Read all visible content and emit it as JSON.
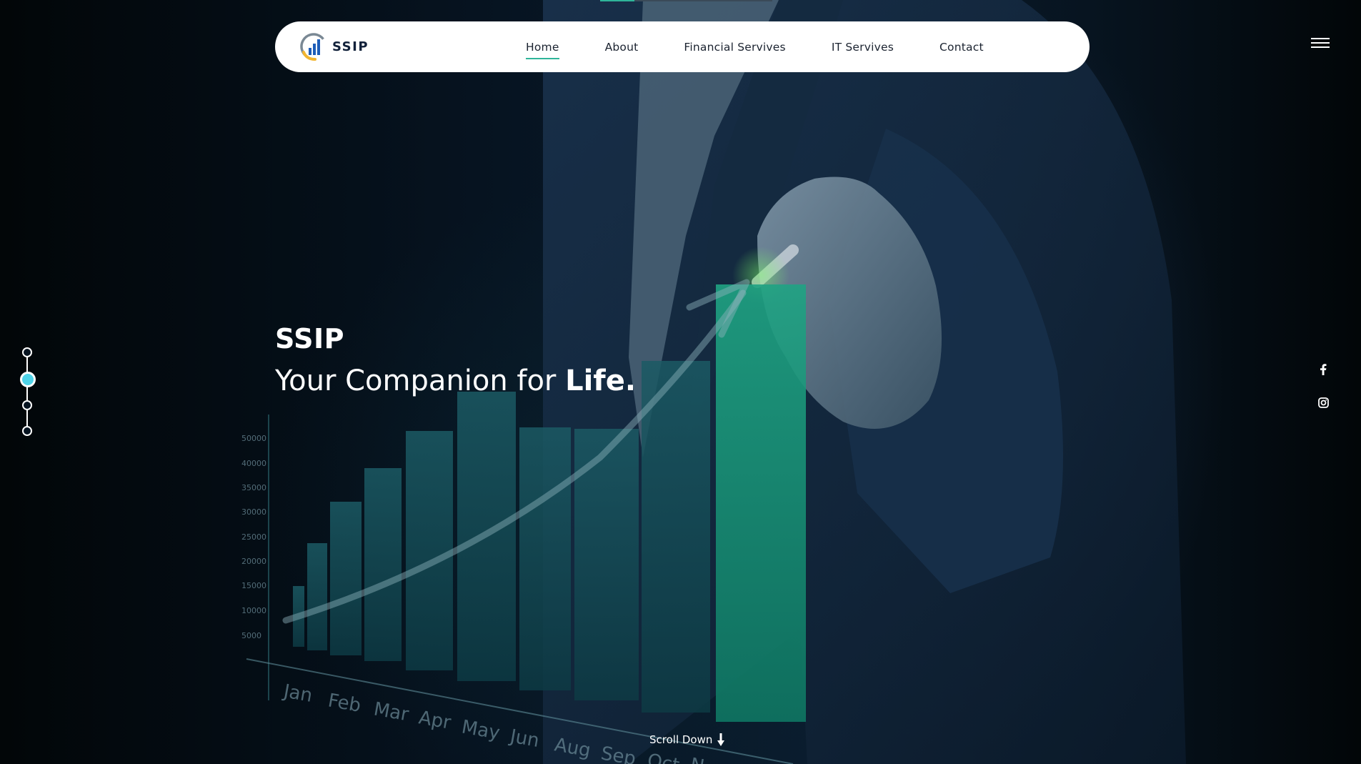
{
  "brand": {
    "name": "SSIP",
    "logo_icon": "bar-chart-logo-icon"
  },
  "nav": {
    "items": [
      {
        "label": "Home",
        "active": true
      },
      {
        "label": "About",
        "active": false
      },
      {
        "label": "Financial Servives",
        "active": false
      },
      {
        "label": "IT Servives",
        "active": false
      },
      {
        "label": "Contact",
        "active": false
      }
    ],
    "menu_icon": "hamburger-menu-icon"
  },
  "hero": {
    "title": "SSIP",
    "subtitle_prefix": "Your Companion for",
    "subtitle_emphasis": "Life.",
    "background": "businessman drawing growth chart",
    "scroll_label": "Scroll Down",
    "scroll_icon": "arrow-down-icon"
  },
  "background_chart": {
    "y_ticks": [
      "50000",
      "40000",
      "35000",
      "30000",
      "25000",
      "20000",
      "15000",
      "10000",
      "5000"
    ],
    "months": [
      "Jan",
      "Feb",
      "Mar",
      "Apr",
      "May",
      "Jun",
      "Aug",
      "Sep",
      "Oct",
      "N"
    ]
  },
  "slide_nav": {
    "count": 4,
    "active_index": 1
  },
  "social": [
    {
      "icon": "facebook-icon"
    },
    {
      "icon": "instagram-icon"
    }
  ],
  "colors": {
    "accent": "#2fb59a",
    "active_dot": "#4fd3e8",
    "background": "#061320",
    "navbar": "#ffffff"
  }
}
